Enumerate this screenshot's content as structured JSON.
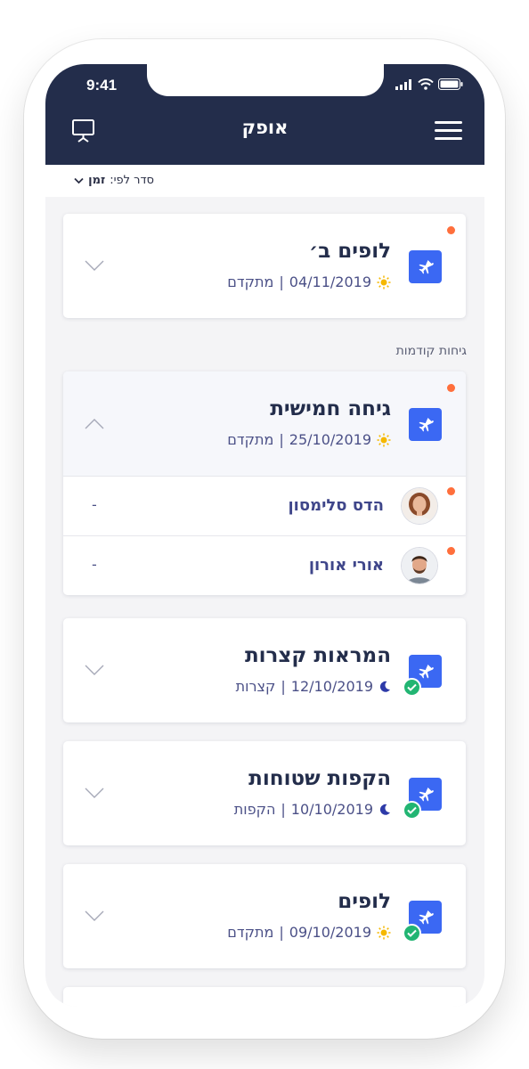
{
  "status": {
    "time": "9:41"
  },
  "header": {
    "title": "אופק"
  },
  "sort": {
    "label": "סדר לפי:",
    "value": "זמן"
  },
  "section_label": "גיחות קודמות",
  "cards": [
    {
      "title": "לופים ב׳",
      "date": "04/11/2019",
      "type": "מתקדם",
      "mode": "day",
      "new": true,
      "done": false
    },
    {
      "title": "גיחה חמישית",
      "date": "25/10/2019",
      "type": "מתקדם",
      "mode": "day",
      "new": true,
      "done": false,
      "expanded": true,
      "participants": [
        {
          "name": "הדס סלימסון",
          "value": "-"
        },
        {
          "name": "אורי אורון",
          "value": "-"
        }
      ]
    },
    {
      "title": "המראות קצרות",
      "date": "12/10/2019",
      "type": "קצרות",
      "mode": "night",
      "new": false,
      "done": true
    },
    {
      "title": "הקפות שטוחות",
      "date": "10/10/2019",
      "type": "הקפות",
      "mode": "night",
      "new": false,
      "done": true
    },
    {
      "title": "לופים",
      "date": "09/10/2019",
      "type": "מתקדם",
      "mode": "day",
      "new": false,
      "done": true
    }
  ],
  "colors": {
    "header": "#232d4b",
    "accent": "#3b68f3",
    "new_dot": "#ff6f3c",
    "done": "#22b573"
  }
}
